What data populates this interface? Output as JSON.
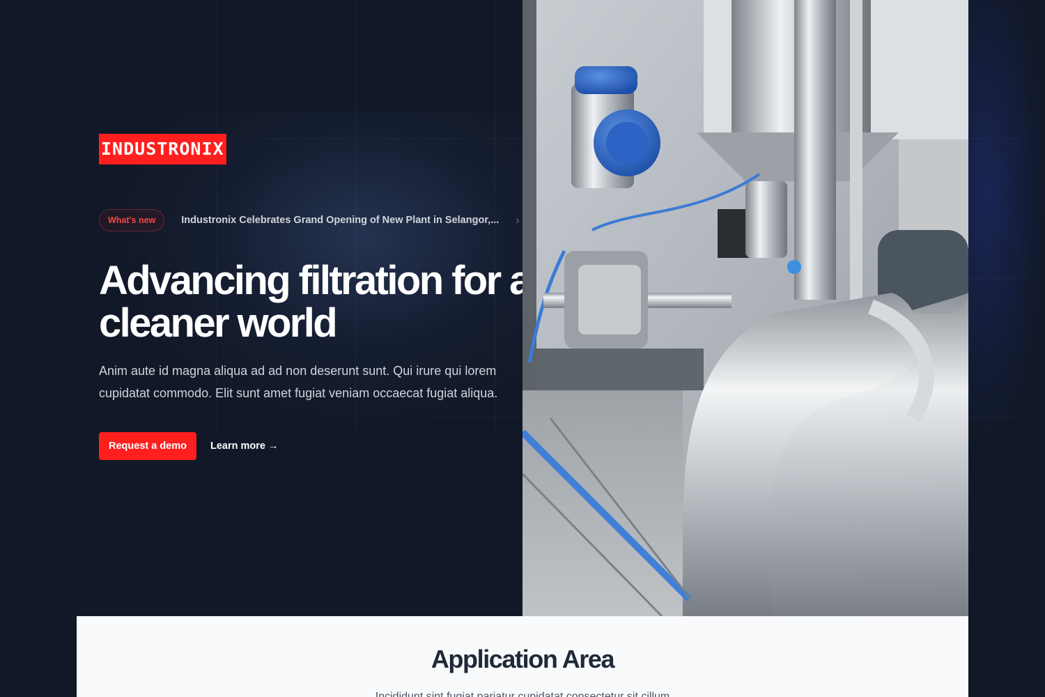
{
  "brand": {
    "logo_text": "INDUSTRONIX",
    "accent_color": "#ff1f1f"
  },
  "announcement": {
    "badge": "What's new",
    "text": "Industronix Celebrates Grand Opening of New Plant in Selangor,...",
    "chevron": "›",
    "icon": "chevron-right-icon"
  },
  "hero": {
    "headline": "Advancing filtration for a cleaner world",
    "description": "Anim aute id magna aliqua ad ad non deserunt sunt. Qui irure qui lorem cupidatat commodo. Elit sunt amet fugiat veniam occaecat fugiat aliqua.",
    "primary_cta": "Request a demo",
    "secondary_cta": "Learn more →",
    "image_alt": "Industrial filtration equipment with stainless steel pipes"
  },
  "application_area": {
    "title": "Application Area",
    "subtitle": "Incididunt sint fugiat pariatur cupidatat consectetur sit cillum"
  },
  "colors": {
    "background": "#111827",
    "section_background": "#f8fafc"
  }
}
